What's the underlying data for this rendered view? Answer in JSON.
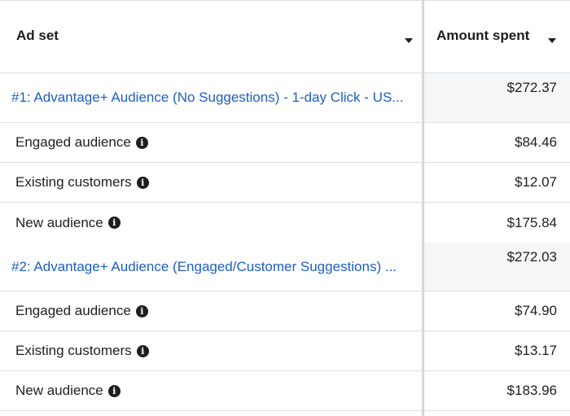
{
  "header": {
    "adset_label": "Ad set",
    "amount_label": "Amount spent"
  },
  "rows": [
    {
      "type": "parent",
      "name": "#1: Advantage+ Audience (No Suggestions) - 1-day Click - US...",
      "amount": "$272.37"
    },
    {
      "type": "child",
      "name": "Engaged audience",
      "amount": "$84.46",
      "icon": "info-icon"
    },
    {
      "type": "child",
      "name": "Existing customers",
      "amount": "$12.07",
      "icon": "info-icon"
    },
    {
      "type": "child",
      "name": "New audience",
      "amount": "$175.84",
      "icon": "info-icon"
    },
    {
      "type": "parent",
      "name": "#2: Advantage+ Audience (Engaged/Customer Suggestions) ...",
      "amount": "$272.03"
    },
    {
      "type": "child",
      "name": "Engaged audience",
      "amount": "$74.90",
      "icon": "info-icon"
    },
    {
      "type": "child",
      "name": "Existing customers",
      "amount": "$13.17",
      "icon": "info-icon"
    },
    {
      "type": "child",
      "name": "New audience",
      "amount": "$183.96",
      "icon": "info-icon"
    }
  ],
  "colors": {
    "link": "#1d5ec6",
    "text": "#1c1e21",
    "border": "#dddfe2",
    "parent_amount_bg": "#f5f6f7"
  }
}
